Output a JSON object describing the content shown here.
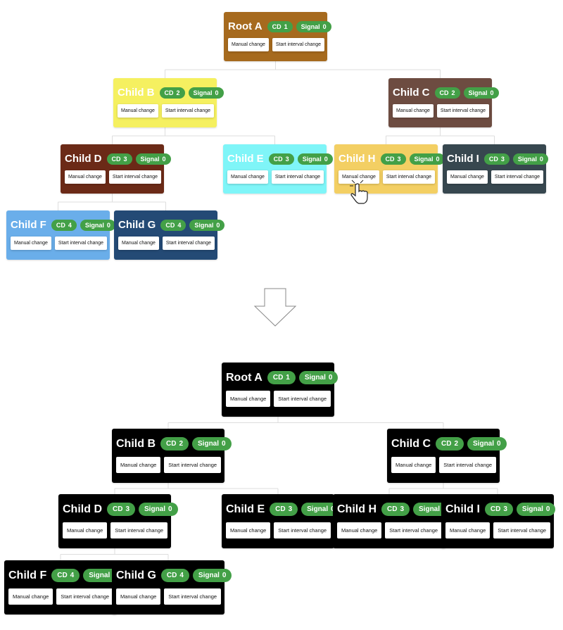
{
  "buttons": {
    "manual": "Manual change",
    "interval": "Start interval change"
  },
  "badge_labels": {
    "cd": "CD",
    "signal": "Signal"
  },
  "badge_color": "#43a047",
  "connector_color": "#dddddd",
  "trees": [
    {
      "name": "before",
      "nodes": [
        {
          "id": "A",
          "label": "Root A",
          "cd": 1,
          "signal": 0,
          "color": "#a66a1e",
          "parent": null
        },
        {
          "id": "B",
          "label": "Child B",
          "cd": 2,
          "signal": 0,
          "color": "#f5f060",
          "parent": "A"
        },
        {
          "id": "C",
          "label": "Child C",
          "cd": 2,
          "signal": 0,
          "color": "#6d4c41",
          "parent": "A"
        },
        {
          "id": "D",
          "label": "Child D",
          "cd": 3,
          "signal": 0,
          "color": "#6b2a17",
          "parent": "B"
        },
        {
          "id": "E",
          "label": "Child E",
          "cd": 3,
          "signal": 0,
          "color": "#7ff5f8",
          "parent": "B"
        },
        {
          "id": "H",
          "label": "Child H",
          "cd": 3,
          "signal": 0,
          "color": "#f3cf63",
          "parent": "C"
        },
        {
          "id": "I",
          "label": "Child I",
          "cd": 3,
          "signal": 0,
          "color": "#37474f",
          "parent": "C"
        },
        {
          "id": "F",
          "label": "Child F",
          "cd": 4,
          "signal": 0,
          "color": "#6aaeea",
          "parent": "D"
        },
        {
          "id": "G",
          "label": "Child G",
          "cd": 4,
          "signal": 0,
          "color": "#244a75",
          "parent": "D"
        }
      ]
    },
    {
      "name": "after",
      "nodes": [
        {
          "id": "A",
          "label": "Root A",
          "cd": 1,
          "signal": 0,
          "color": "#000000",
          "parent": null
        },
        {
          "id": "B",
          "label": "Child B",
          "cd": 2,
          "signal": 0,
          "color": "#000000",
          "parent": "A"
        },
        {
          "id": "C",
          "label": "Child C",
          "cd": 2,
          "signal": 0,
          "color": "#000000",
          "parent": "A"
        },
        {
          "id": "D",
          "label": "Child D",
          "cd": 3,
          "signal": 0,
          "color": "#000000",
          "parent": "B"
        },
        {
          "id": "E",
          "label": "Child E",
          "cd": 3,
          "signal": 0,
          "color": "#000000",
          "parent": "B"
        },
        {
          "id": "H",
          "label": "Child H",
          "cd": 3,
          "signal": 0,
          "color": "#000000",
          "parent": "C"
        },
        {
          "id": "I",
          "label": "Child I",
          "cd": 3,
          "signal": 0,
          "color": "#000000",
          "parent": "C"
        },
        {
          "id": "F",
          "label": "Child F",
          "cd": 4,
          "signal": 0,
          "color": "#000000",
          "parent": "D"
        },
        {
          "id": "G",
          "label": "Child G",
          "cd": 4,
          "signal": 0,
          "color": "#000000",
          "parent": "D"
        }
      ]
    }
  ],
  "cursor": {
    "icon": "hand-pointer-icon",
    "target": "before H manual"
  },
  "transition_arrow": {
    "icon": "arrow-down-icon"
  }
}
